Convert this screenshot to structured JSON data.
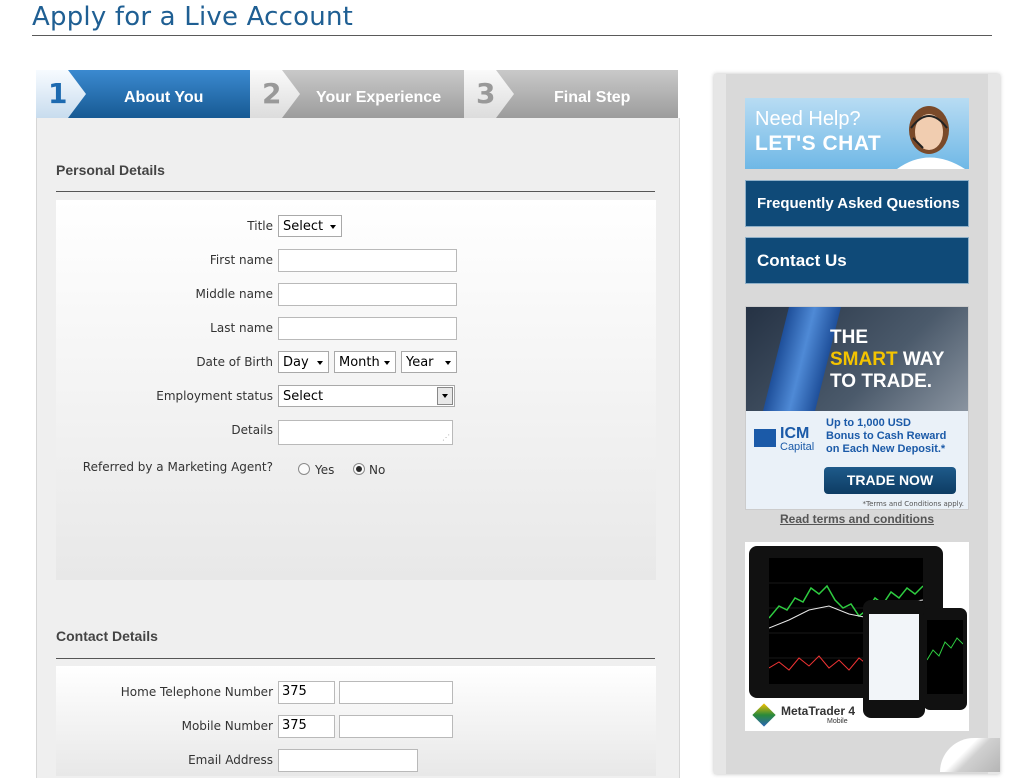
{
  "page": {
    "title": "Apply for a Live Account"
  },
  "steps": [
    {
      "number": "1",
      "label": "About You",
      "active": true
    },
    {
      "number": "2",
      "label": "Your Experience",
      "active": false
    },
    {
      "number": "3",
      "label": "Final Step",
      "active": false
    }
  ],
  "personal": {
    "heading": "Personal Details",
    "title_label": "Title",
    "title_value": "Select",
    "first_name_label": "First name",
    "middle_name_label": "Middle name",
    "last_name_label": "Last name",
    "dob_label": "Date of Birth",
    "dob_day": "Day",
    "dob_month": "Month",
    "dob_year": "Year",
    "employment_label": "Employment status",
    "employment_value": "Select",
    "details_label": "Details",
    "referred_label": "Referred by a Marketing Agent?",
    "referred_yes": "Yes",
    "referred_no": "No",
    "referred_selected": "No"
  },
  "contact": {
    "heading": "Contact Details",
    "home_phone_label": "Home Telephone Number",
    "home_phone_code": "375",
    "mobile_label": "Mobile Number",
    "mobile_code": "375",
    "email_label": "Email Address"
  },
  "sidebar": {
    "chat_line1": "Need Help?",
    "chat_line2": "LET'S CHAT",
    "faq_label": "Frequently Asked Questions",
    "contact_label": "Contact Us",
    "ad": {
      "headline_1": "THE",
      "headline_smart": "SMART",
      "headline_2": "WAY",
      "headline_3": "TO TRADE.",
      "logo_icm": "ICM",
      "logo_capital": "Capital",
      "offer_1": "Up to 1,000 USD",
      "offer_2": "Bonus to Cash Reward",
      "offer_3": "on Each New Deposit.*",
      "cta": "TRADE NOW",
      "terms_note": "*Terms and Conditions apply."
    },
    "terms_link": "Read terms and conditions",
    "mt_name": "MetaTrader 4",
    "mt_sub": "Mobile"
  },
  "colors": {
    "brand_blue": "#1f5f93",
    "nav_blue": "#0f4a78",
    "step_active": "#1e6aa5",
    "step_inactive": "#b0b0b0"
  }
}
